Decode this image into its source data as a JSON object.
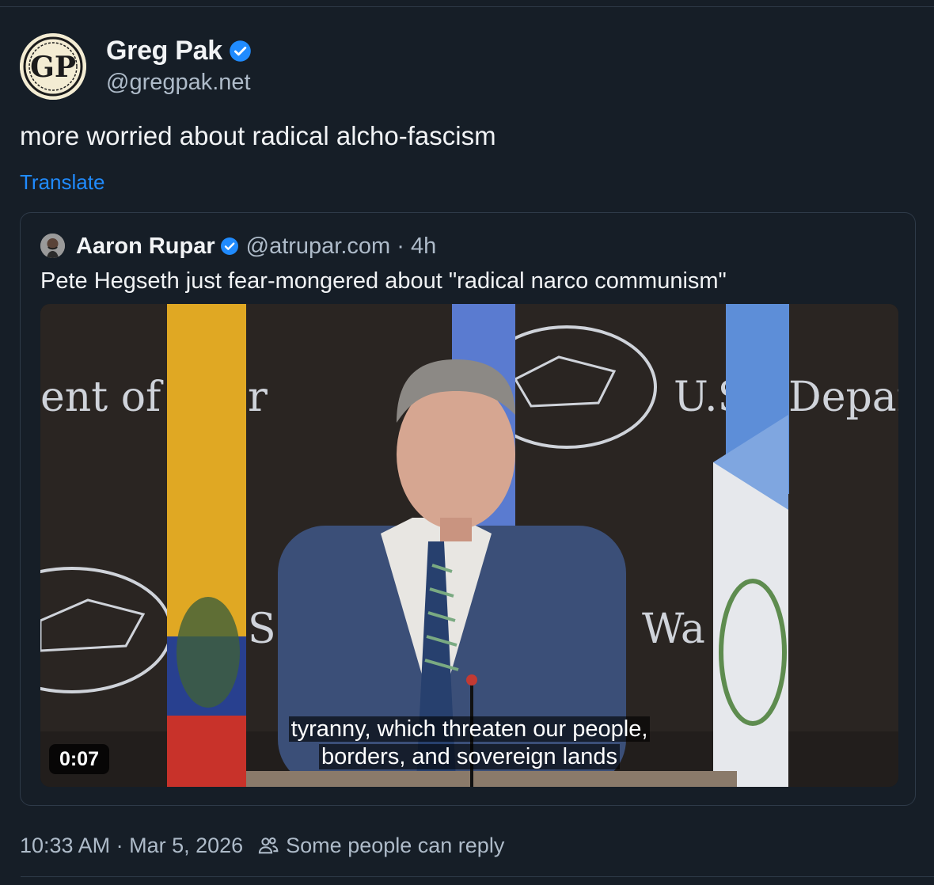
{
  "post": {
    "author": {
      "display_name": "Greg Pak",
      "handle": "@gregpak.net",
      "avatar_text": "GP",
      "verified": true
    },
    "text": "more worried about radical alcho-fascism",
    "translate_label": "Translate",
    "timestamp": "10:33 AM · Mar 5, 2026",
    "reply_setting": "Some people can reply"
  },
  "quote": {
    "author": {
      "display_name": "Aaron Rupar",
      "handle": "@atrupar.com · 4h",
      "verified": true
    },
    "text": "Pete Hegseth just fear-mongered about \"radical narco communism\"",
    "video": {
      "duration": "0:07",
      "caption_line1": "tyranny, which threaten our people,",
      "caption_line2": "borders, and sovereign lands",
      "backdrop_text_left": "ent of",
      "backdrop_text_left2": "r",
      "backdrop_text_right": "U.S",
      "backdrop_text_right2": "Depar",
      "backdrop_text_lower": "Wa",
      "backdrop_text_lower_s": "S"
    }
  },
  "colors": {
    "background": "#161e27",
    "link": "#208bfe",
    "verified": "#208bfe",
    "muted_text": "#aebbc9",
    "border": "#2e3a48"
  },
  "icons": [
    "verified-badge-icon",
    "people-icon"
  ]
}
